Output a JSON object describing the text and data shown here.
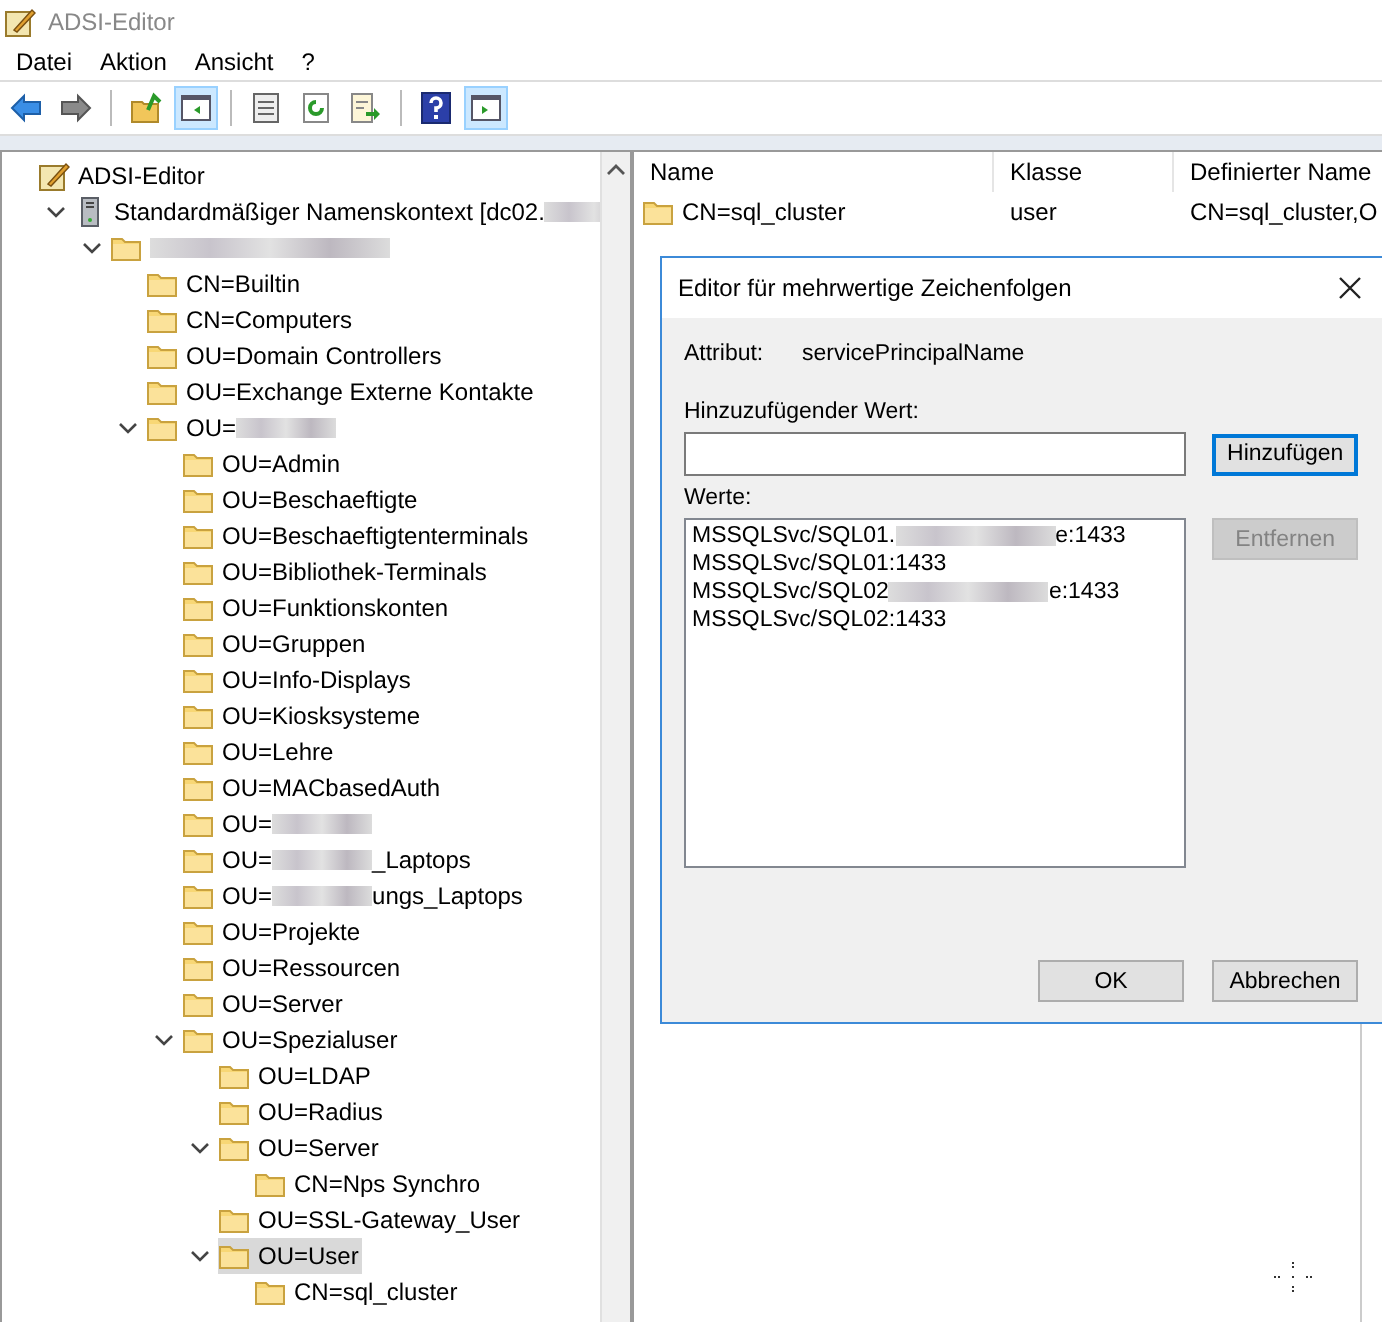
{
  "window": {
    "title": "ADSI-Editor"
  },
  "menu": [
    "Datei",
    "Aktion",
    "Ansicht",
    "?"
  ],
  "toolbar": [
    {
      "kind": "back",
      "selected": false
    },
    {
      "kind": "forward",
      "selected": false
    },
    {
      "kind": "sep"
    },
    {
      "kind": "up",
      "selected": false
    },
    {
      "kind": "tree",
      "selected": true
    },
    {
      "kind": "sep"
    },
    {
      "kind": "props",
      "selected": false
    },
    {
      "kind": "refresh",
      "selected": false
    },
    {
      "kind": "export",
      "selected": false
    },
    {
      "kind": "sep"
    },
    {
      "kind": "help",
      "selected": false
    },
    {
      "kind": "pane",
      "selected": true
    }
  ],
  "tree": [
    {
      "label": "ADSI-Editor",
      "kind": "app",
      "selected": false,
      "children": [
        {
          "label": "Standardmäßiger Namenskontext [dc02.",
          "redacted": true,
          "kind": "server",
          "expanded": true,
          "selected": false,
          "children": [
            {
              "kind": "folder",
              "redacted": true,
              "expanded": true,
              "selected": false,
              "children": [
                {
                  "label": "CN=Builtin",
                  "kind": "folder",
                  "selected": false
                },
                {
                  "label": "CN=Computers",
                  "kind": "folder",
                  "selected": false
                },
                {
                  "label": "OU=Domain Controllers",
                  "kind": "folder",
                  "selected": false
                },
                {
                  "label": "OU=Exchange Externe Kontakte",
                  "kind": "folder",
                  "selected": false
                },
                {
                  "label": "OU=",
                  "redacted": true,
                  "kind": "folder",
                  "expanded": true,
                  "selected": false,
                  "children": [
                    {
                      "label": "OU=Admin",
                      "kind": "folder",
                      "selected": false
                    },
                    {
                      "label": "OU=Beschaeftigte",
                      "kind": "folder",
                      "selected": false
                    },
                    {
                      "label": "OU=Beschaeftigtenterminals",
                      "kind": "folder",
                      "selected": false
                    },
                    {
                      "label": "OU=Bibliothek-Terminals",
                      "kind": "folder",
                      "selected": false
                    },
                    {
                      "label": "OU=Funktionskonten",
                      "kind": "folder",
                      "selected": false
                    },
                    {
                      "label": "OU=Gruppen",
                      "kind": "folder",
                      "selected": false
                    },
                    {
                      "label": "OU=Info-Displays",
                      "kind": "folder",
                      "selected": false
                    },
                    {
                      "label": "OU=Kiosksysteme",
                      "kind": "folder",
                      "selected": false
                    },
                    {
                      "label": "OU=Lehre",
                      "kind": "folder",
                      "selected": false
                    },
                    {
                      "label": "OU=MACbasedAuth",
                      "kind": "folder",
                      "selected": false
                    },
                    {
                      "label": "OU=",
                      "redacted": true,
                      "kind": "folder",
                      "selected": false
                    },
                    {
                      "label": "OU=",
                      "redacted": true,
                      "suffix": "_Laptops",
                      "kind": "folder",
                      "selected": false
                    },
                    {
                      "label": "OU=",
                      "redacted": true,
                      "suffix": "ungs_Laptops",
                      "kind": "folder",
                      "selected": false
                    },
                    {
                      "label": "OU=Projekte",
                      "kind": "folder",
                      "selected": false
                    },
                    {
                      "label": "OU=Ressourcen",
                      "kind": "folder",
                      "selected": false
                    },
                    {
                      "label": "OU=Server",
                      "kind": "folder",
                      "selected": false
                    },
                    {
                      "label": "OU=Spezialuser",
                      "kind": "folder",
                      "expanded": true,
                      "selected": false,
                      "children": [
                        {
                          "label": "OU=LDAP",
                          "kind": "folder",
                          "selected": false
                        },
                        {
                          "label": "OU=Radius",
                          "kind": "folder",
                          "selected": false
                        },
                        {
                          "label": "OU=Server",
                          "kind": "folder",
                          "expanded": true,
                          "selected": false,
                          "children": [
                            {
                              "label": "CN=Nps Synchro",
                              "kind": "folder",
                              "selected": false
                            }
                          ]
                        },
                        {
                          "label": "OU=SSL-Gateway_User",
                          "kind": "folder",
                          "selected": false
                        },
                        {
                          "label": "OU=User",
                          "kind": "folder",
                          "expanded": true,
                          "selected": true,
                          "children": [
                            {
                              "label": "CN=sql_cluster",
                              "kind": "folder",
                              "selected": false
                            }
                          ]
                        }
                      ]
                    }
                  ]
                }
              ]
            }
          ]
        }
      ]
    }
  ],
  "list": {
    "columns": [
      "Name",
      "Klasse",
      "Definierter Name"
    ],
    "rows": [
      {
        "name": "CN=sql_cluster",
        "class": "user",
        "dn": "CN=sql_cluster,O"
      }
    ]
  },
  "dialog": {
    "title": "Editor für mehrwertige Zeichenfolgen",
    "attribute_label": "Attribut:",
    "attribute_value": "servicePrincipalName",
    "add_label": "Hinzuzufügender Wert:",
    "add_button": "Hinzufügen",
    "values_label": "Werte:",
    "values": [
      {
        "text": "MSSQLSvc/SQL01.",
        "redacted": true,
        "suffix": "e:1433"
      },
      {
        "text": "MSSQLSvc/SQL01:1433"
      },
      {
        "text": "MSSQLSvc/SQL02",
        "redacted": true,
        "suffix": "e:1433"
      },
      {
        "text": "MSSQLSvc/SQL02:1433"
      }
    ],
    "remove_button": {
      "label": "Entfernen",
      "disabled": true
    },
    "ok_button": "OK",
    "cancel_button": "Abbrechen"
  }
}
